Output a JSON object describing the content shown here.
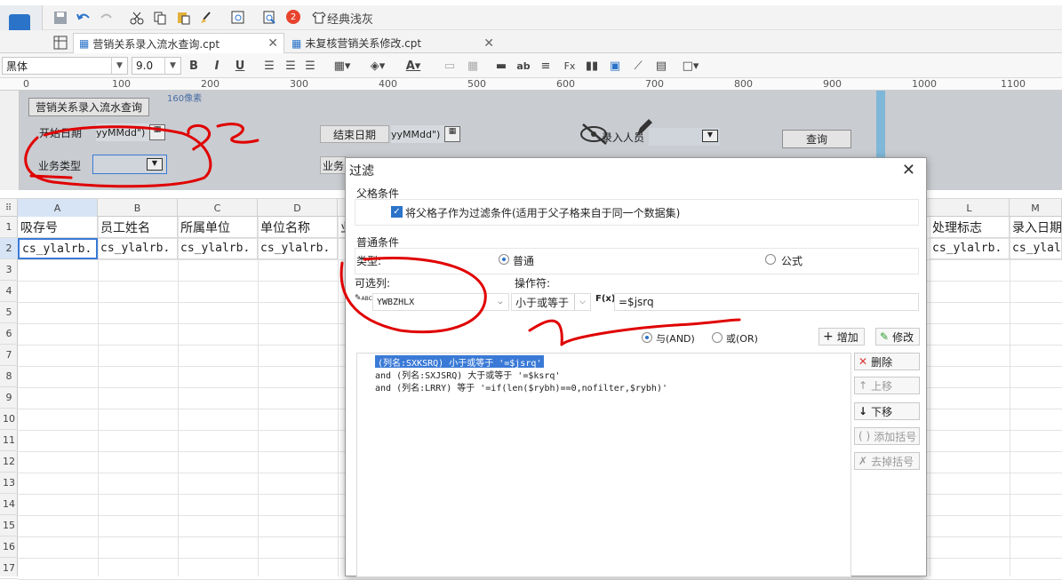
{
  "toolbar": {
    "style_button": "经典浅灰",
    "badge": "2"
  },
  "tabs": [
    {
      "label": "营销关系录入流水查询.cpt"
    },
    {
      "label": "未复核营销关系修改.cpt"
    }
  ],
  "format": {
    "font": "黑体",
    "size": "9.0",
    "bold": "B",
    "italic": "I",
    "underline": "U",
    "text_btn": "ab"
  },
  "ruler": {
    "ticks": [
      "0",
      "100",
      "200",
      "300",
      "400",
      "500",
      "600",
      "700",
      "800",
      "900",
      "1000",
      "1100"
    ],
    "marker": "160像素"
  },
  "params": {
    "report_title": "营销关系录入流水查询",
    "start_label": "开始日期",
    "start_value": "yyMMdd\")",
    "end_label": "结束日期",
    "end_value": "yyMMdd\")",
    "type_label": "业务类型",
    "type2_label": "业务",
    "entry_label": "录入人员",
    "query_button": "查询"
  },
  "grid": {
    "columns": [
      "A",
      "B",
      "C",
      "D",
      "L",
      "M"
    ],
    "rows": [
      "1",
      "2",
      "3",
      "4",
      "5",
      "6",
      "7",
      "8",
      "9",
      "10",
      "11",
      "12",
      "13",
      "14",
      "15",
      "16",
      "17"
    ],
    "headers": [
      "吸存号",
      "员工姓名",
      "所属单位",
      "单位名称",
      "处理标志",
      "录入日期"
    ],
    "values": [
      "cs_ylalrb.",
      "cs_ylalrb.",
      "cs_ylalrb.",
      "cs_ylalrb.",
      "cs_ylalrb.",
      "cs_ylal"
    ],
    "partial_header": "业"
  },
  "dialog": {
    "title": "过滤",
    "parent_section": "父格条件",
    "parent_checkbox": "将父格子作为过滤条件(适用于父子格来自于同一个数据集)",
    "normal_section": "普通条件",
    "type_label": "类型:",
    "radio_normal": "普通",
    "radio_formula": "公式",
    "column_label": "可选列:",
    "column_value": "YWBZHLX",
    "operator_label": "操作符:",
    "operator_value": "小于或等于",
    "formula_icon": "F(x)",
    "value_input": "=$jsrq",
    "and_label": "与(AND)",
    "or_label": "或(OR)",
    "add_button": "增加",
    "modify_button": "修改",
    "delete_button": "删除",
    "up_button": "上移",
    "down_button": "下移",
    "add_bracket": "添加括号",
    "remove_bracket": "去掉括号",
    "conditions": [
      "(列名:SXKSRQ) 小于或等于 '=$jsrq'",
      "and (列名:SXJSRQ) 大于或等于 '=$ksrq'",
      "and (列名:LRRY) 等于 '=if(len($rybh)==0,nofilter,$rybh)'"
    ]
  },
  "colors": {
    "accent": "#2b73c9",
    "annotation": "#e00000",
    "param_bg": "#c9ccd1",
    "selection": "#3a7ad6"
  }
}
